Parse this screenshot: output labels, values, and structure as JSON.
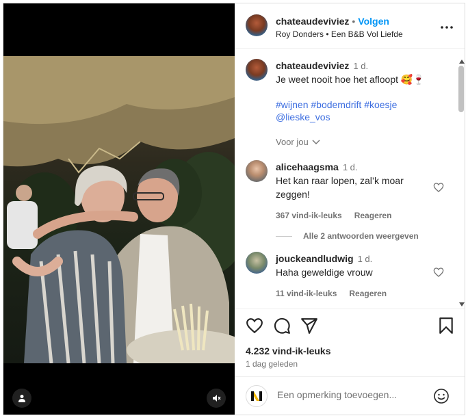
{
  "header": {
    "username": "chateaudeviviez",
    "dot": "•",
    "follow_label": "Volgen",
    "subtitle": "Roy Donders • Een B&B Vol Liefde"
  },
  "caption": {
    "username": "chateaudeviviez",
    "time": "1 d.",
    "text": "Je weet nooit hoe het afloopt 🥰🍷",
    "hashtags": [
      "#wijnen",
      "#bodemdrift",
      "#koesje"
    ],
    "mention": "@lieske_vos",
    "see_translation": "Voor jou"
  },
  "comments": [
    {
      "username": "alicehaagsma",
      "time": "1 d.",
      "text": "Het kan raar lopen, zal’k moar zeggen!",
      "likes": "367 vind-ik-leuks",
      "reply_label": "Reageren",
      "replies_label": "Alle 2 antwoorden weergeven"
    },
    {
      "username": "jouckeandludwig",
      "time": "1 d.",
      "text": "Haha geweldige vrouw",
      "likes": "11 vind-ik-leuks",
      "reply_label": "Reageren"
    }
  ],
  "post": {
    "likes": "4.232 vind-ik-leuks",
    "posted": "1 dag geleden"
  },
  "composer": {
    "placeholder": "Een opmerking toevoegen..."
  },
  "icons": {
    "like": "heart-icon",
    "comment": "comment-icon",
    "share": "share-icon",
    "save": "bookmark-icon",
    "more": "more-icon",
    "emoji": "emoji-icon",
    "user": "user-icon",
    "mute": "mute-icon"
  },
  "colors": {
    "link": "#0095f6",
    "hashtag": "#3d6ee0",
    "muted": "#737373",
    "text": "#262626"
  }
}
